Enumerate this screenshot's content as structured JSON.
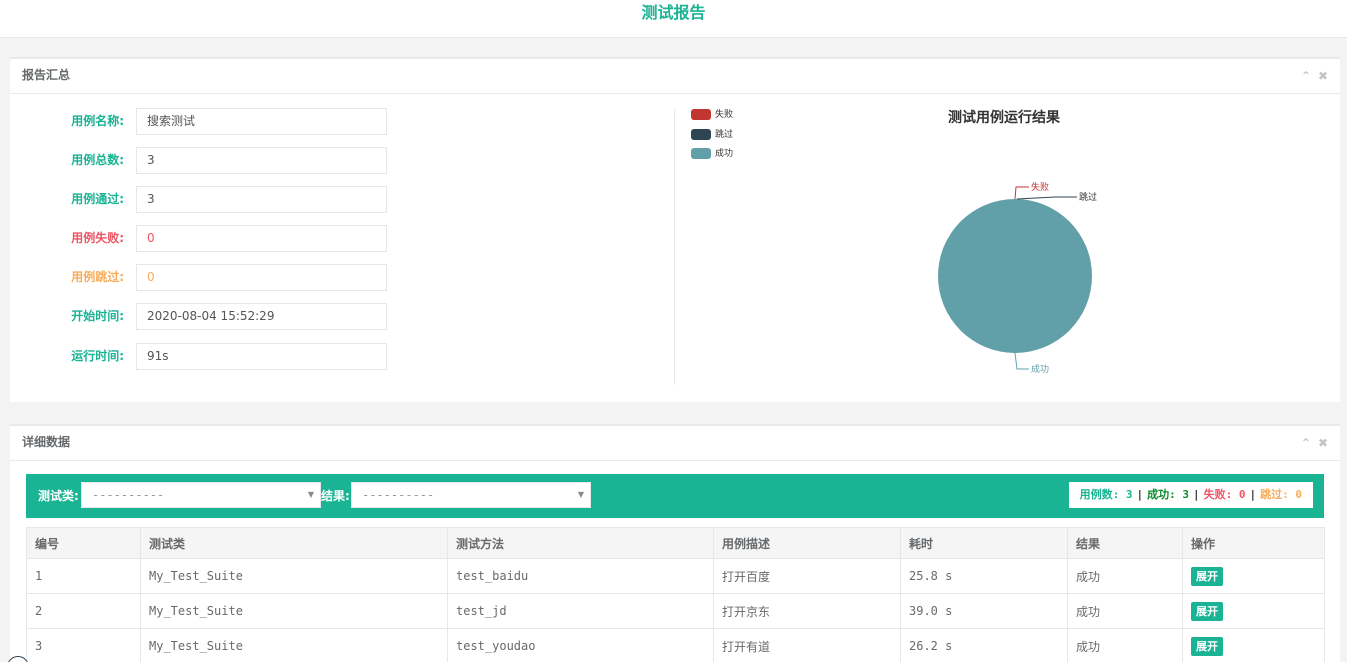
{
  "page": {
    "title": "测试报告"
  },
  "summary": {
    "panel_title": "报告汇总",
    "tools": {
      "collapse_icon": "chevron-up-icon",
      "close_icon": "close-icon"
    },
    "fields": [
      {
        "label": "用例名称:",
        "value": "搜索测试",
        "color": "#1ab394",
        "value_color": "#555555"
      },
      {
        "label": "用例总数:",
        "value": "3",
        "color": "#1ab394",
        "value_color": "#555555"
      },
      {
        "label": "用例通过:",
        "value": "3",
        "color": "#1ab394",
        "value_color": "#555555"
      },
      {
        "label": "用例失败:",
        "value": "0",
        "color": "#ed5565",
        "value_color": "#ed5565"
      },
      {
        "label": "用例跳过:",
        "value": "0",
        "color": "#f8ac59",
        "value_color": "#f8ac59"
      },
      {
        "label": "开始时间:",
        "value": "2020-08-04 15:52:29",
        "color": "#1ab394",
        "value_color": "#555555"
      },
      {
        "label": "运行时间:",
        "value": "91s",
        "color": "#1ab394",
        "value_color": "#555555"
      }
    ]
  },
  "chart_data": {
    "type": "pie",
    "title": "测试用例运行结果",
    "legend_position": "top-left",
    "series": [
      {
        "name": "失败",
        "value": 0,
        "color": "#c23531"
      },
      {
        "name": "跳过",
        "value": 0,
        "color": "#2f4554"
      },
      {
        "name": "成功",
        "value": 3,
        "color": "#61a0a8"
      }
    ]
  },
  "detail": {
    "panel_title": "详细数据",
    "filters": {
      "class_label": "测试类:",
      "class_value": "----------",
      "result_label": "结果:",
      "result_value": "----------"
    },
    "stats": {
      "total_label": "用例数: 3",
      "pass_label": "成功: 3",
      "fail_label": "失败: 0",
      "skip_label": "跳过: 0",
      "separator": "|"
    },
    "columns": [
      "编号",
      "测试类",
      "测试方法",
      "用例描述",
      "耗时",
      "结果",
      "操作"
    ],
    "rows": [
      {
        "id": "1",
        "class": "My_Test_Suite",
        "method": "test_baidu",
        "desc": "打开百度",
        "time": "25.8 s",
        "result": "成功",
        "action": "展开"
      },
      {
        "id": "2",
        "class": "My_Test_Suite",
        "method": "test_jd",
        "desc": "打开京东",
        "time": "39.0 s",
        "result": "成功",
        "action": "展开"
      },
      {
        "id": "3",
        "class": "My_Test_Suite",
        "method": "test_youdao",
        "desc": "打开有道",
        "time": "26.2 s",
        "result": "成功",
        "action": "展开"
      }
    ]
  }
}
